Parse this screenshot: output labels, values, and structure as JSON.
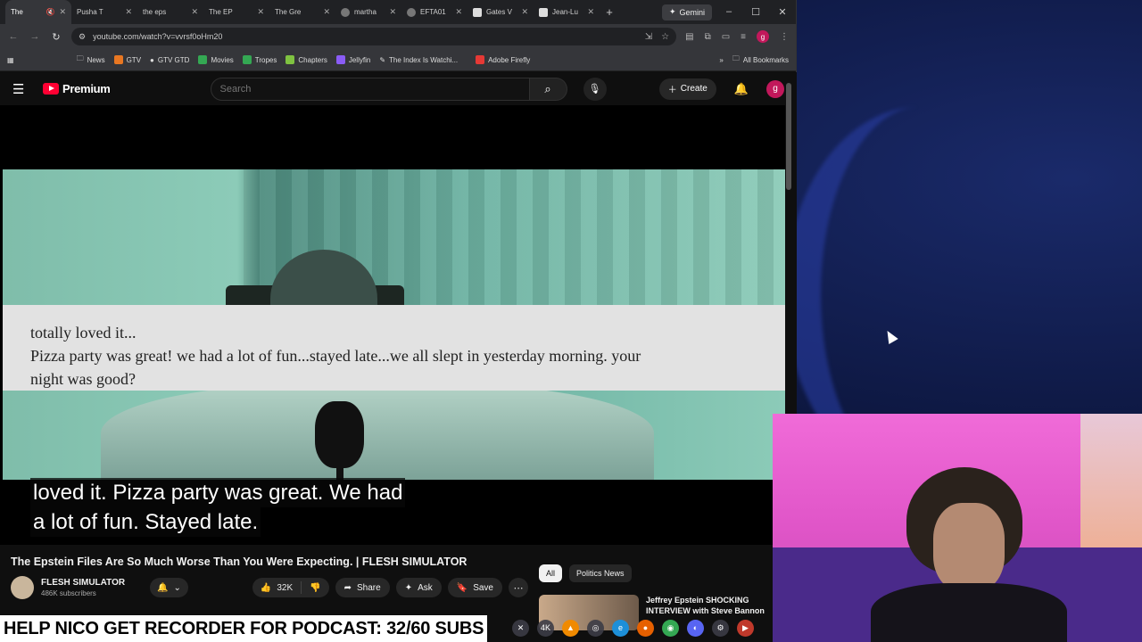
{
  "browser": {
    "tabs": [
      {
        "label": "The",
        "favicon": "youtube-icon",
        "active": true
      },
      {
        "label": "Pusha T",
        "favicon": "youtube-icon"
      },
      {
        "label": "the eps",
        "favicon": "youtube-icon"
      },
      {
        "label": "The EP",
        "favicon": "youtube-icon"
      },
      {
        "label": "The Gre",
        "favicon": "youtube-icon"
      },
      {
        "label": "martha",
        "favicon": "chatgpt-icon"
      },
      {
        "label": "EFTA01",
        "favicon": "globe-icon"
      },
      {
        "label": "Gates V",
        "favicon": "wikipedia-icon"
      },
      {
        "label": "Jean-Lu",
        "favicon": "wikipedia-icon"
      }
    ],
    "gemini_label": "Gemini",
    "url": "youtube.com/watch?v=vvrsf0oHm20",
    "bookmarks": [
      "News",
      "GTV",
      "GTV GTD",
      "Movies",
      "Tropes",
      "Chapters",
      "Jellyfin",
      "The Index Is Watchi...",
      "Adobe Firefly"
    ],
    "all_bookmarks": "All Bookmarks"
  },
  "youtube": {
    "logo_text": "Premium",
    "search_placeholder": "Search",
    "create_label": "Create",
    "avatar_letter": "g",
    "video": {
      "document_lines": [
        "totally loved it...",
        "Pizza party was great!  we had a lot of fun...stayed late...we all slept in yesterday morning.  your",
        "night was good?"
      ],
      "caption_lines": [
        "loved it. Pizza party was great. We had",
        "a lot of fun. Stayed late."
      ]
    },
    "title": "The Epstein Files Are So Much Worse Than You Were Expecting. | FLESH SIMULATOR",
    "channel_name": "FLESH SIMULATOR",
    "subscribers": "486K subscribers",
    "likes": "32K",
    "share_label": "Share",
    "ask_label": "Ask",
    "save_label": "Save",
    "chips": [
      "All",
      "Politics News"
    ],
    "rec_title": "Jeffrey Epstein SHOCKING INTERVIEW with Steve Bannon"
  },
  "banner_text": "HELP NICO GET RECORDER FOR PODCAST: 32/60 SUBS",
  "colors": {
    "youtube_red": "#ff0033",
    "accent_pink": "#c2185b"
  }
}
